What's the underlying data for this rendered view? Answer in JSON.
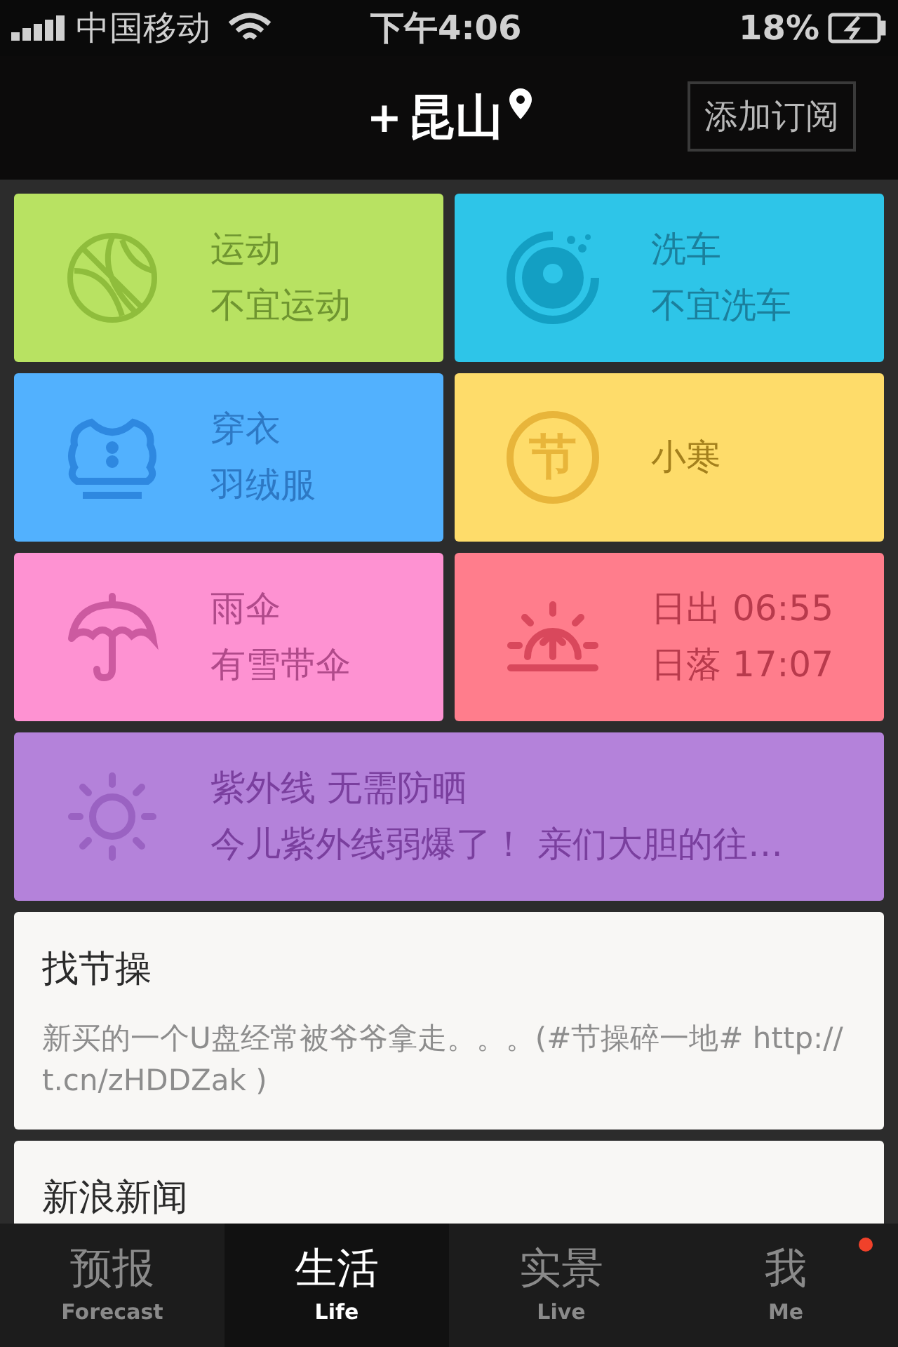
{
  "status_bar": {
    "carrier": "中国移动",
    "time": "下午4:06",
    "battery": "18%"
  },
  "header": {
    "plus": "+",
    "city": "昆山",
    "subscribe_button": "添加订阅"
  },
  "tiles": [
    {
      "kind": "sport",
      "color": "#b8e262",
      "title": "运动",
      "lines": [
        "不宜运动"
      ]
    },
    {
      "kind": "carwash",
      "color": "#2ec5e8",
      "title": "洗车",
      "lines": [
        "不宜洗车"
      ]
    },
    {
      "kind": "clothing",
      "color": "#52b1fe",
      "title": "穿衣",
      "lines": [
        "羽绒服"
      ]
    },
    {
      "kind": "festival",
      "color": "#fedc6a",
      "icon_text": "节",
      "title": "小寒"
    },
    {
      "kind": "umbrella",
      "color": "#fe92d2",
      "title": "雨伞",
      "lines": [
        "有雪带伞"
      ]
    },
    {
      "kind": "sun",
      "color": "#ff7d8c",
      "title": "日出 06:55",
      "lines": [
        "日落 17:07"
      ]
    },
    {
      "kind": "uv",
      "color": "#b482da",
      "title": "紫外线 无需防晒",
      "lines": [
        "今儿紫外线弱爆了！ 亲们大胆的往…"
      ]
    }
  ],
  "cards": [
    {
      "title": "找节操",
      "body": "新买的一个U盘经常被爷爷拿走。。。(#节操碎一地# http://t.cn/zHDDZak )"
    },
    {
      "title": "新浪新闻"
    }
  ],
  "tabs": [
    {
      "label": "预报",
      "sublabel": "Forecast",
      "selected": false,
      "badge": false
    },
    {
      "label": "生活",
      "sublabel": "Life",
      "selected": true,
      "badge": false
    },
    {
      "label": "实景",
      "sublabel": "Live",
      "selected": false,
      "badge": false
    },
    {
      "label": "我",
      "sublabel": "Me",
      "selected": false,
      "badge": true
    }
  ]
}
